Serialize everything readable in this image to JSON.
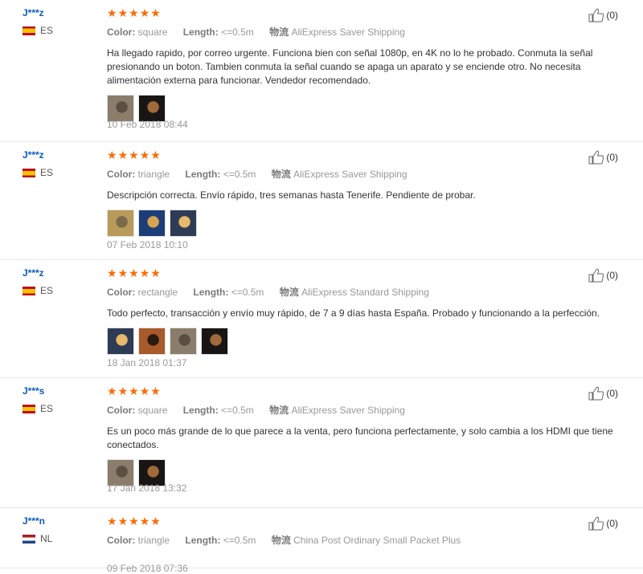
{
  "labels": {
    "color": "Color:",
    "length": "Length:",
    "shipping": "物流"
  },
  "reviews": [
    {
      "user": "J***z",
      "country": "ES",
      "flag": "es",
      "color": "square",
      "length": "<=0.5m",
      "shipping": "AliExpress Saver Shipping",
      "text": "Ha llegado rapido, por correo urgente. Funciona bien con señal 1080p, en 4K no lo he probado. Conmuta la señal presionando un boton. Tambien conmuta la señal cuando se apaga un aparato y se enciende otro. No necesita alimentación externa para funcionar. Vendedor recomendado.",
      "photos": 2,
      "date": "10 Feb 2018 08:44",
      "helpful": "(0)",
      "rating": 5
    },
    {
      "user": "J***z",
      "country": "ES",
      "flag": "es",
      "color": "triangle",
      "length": "<=0.5m",
      "shipping": "AliExpress Saver Shipping",
      "text": "Descripción correcta. Envío rápido, tres semanas hasta Tenerife. Pendiente de probar.",
      "photos": 3,
      "date": "07 Feb 2018 10:10",
      "helpful": "(0)",
      "rating": 5
    },
    {
      "user": "J***z",
      "country": "ES",
      "flag": "es",
      "color": "rectangle",
      "length": "<=0.5m",
      "shipping": "AliExpress Standard Shipping",
      "text": "Todo perfecto, transacción y envío muy rápido, de 7 a 9 días hasta España. Probado y funcionando a la perfección.",
      "photos": 4,
      "date": "18 Jan 2018 01:37",
      "helpful": "(0)",
      "rating": 5
    },
    {
      "user": "J***s",
      "country": "ES",
      "flag": "es",
      "color": "square",
      "length": "<=0.5m",
      "shipping": "AliExpress Saver Shipping",
      "text": "Es un poco más grande de lo que parece a la venta, pero funciona perfectamente, y solo cambia a los HDMI que tiene conectados.",
      "photos": 2,
      "date": "17 Jan 2018 13:32",
      "helpful": "(0)",
      "rating": 5
    },
    {
      "user": "J***n",
      "country": "NL",
      "flag": "nl",
      "color": "triangle",
      "length": "<=0.5m",
      "shipping": "China Post Ordinary Small Packet Plus",
      "text": "",
      "photos": 0,
      "date": "09 Feb 2018 07:36",
      "helpful": "(0)",
      "rating": 5
    }
  ]
}
